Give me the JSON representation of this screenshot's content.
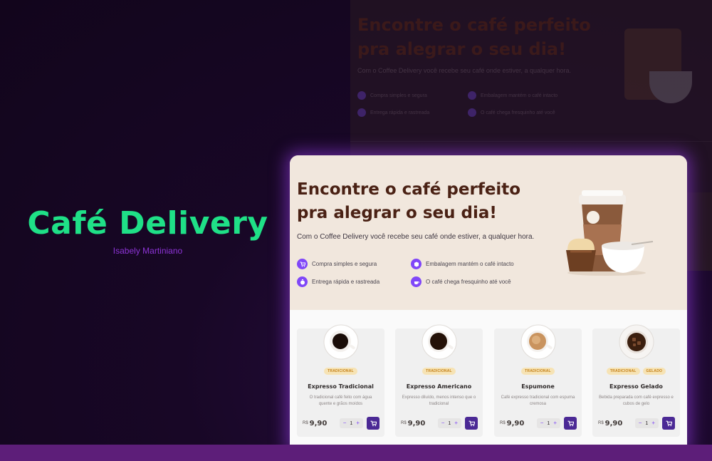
{
  "brand": {
    "title": "Café Delivery",
    "author": "Isabely Martiniano"
  },
  "background_copy": {
    "title": "Encontre o café perfeito pra alegrar o seu dia!",
    "subtitle": "Com o Coffee Delivery você recebe seu café onde estiver, a qualquer hora.",
    "features": [
      "Compra simples e segura",
      "Embalagem mantém o café intacto",
      "Entrega rápida e rastreada",
      "O café chega fresquinho até você"
    ]
  },
  "hero": {
    "title_line1": "Encontre o café perfeito",
    "title_line2": "pra alegrar o seu dia!",
    "subtitle": "Com o Coffee Delivery você recebe seu café onde estiver, a qualquer hora.",
    "features": [
      {
        "label": "Compra simples e segura",
        "icon": "cart-icon",
        "symbol": "🛒"
      },
      {
        "label": "Embalagem mantém o café intacto",
        "icon": "package-icon",
        "symbol": "◈"
      },
      {
        "label": "Entrega rápida e rastreada",
        "icon": "timer-icon",
        "symbol": "◷"
      },
      {
        "label": "O café chega fresquinho até você",
        "icon": "coffee-icon",
        "symbol": "☕"
      }
    ]
  },
  "products": [
    {
      "name": "Expresso Tradicional",
      "tags": [
        "Tradicional"
      ],
      "description": "O tradicional café feito com água quente e grãos moídos",
      "currency": "R$",
      "price": "9,90",
      "quantity": "1",
      "coffee_color": "#1a0d08"
    },
    {
      "name": "Expresso Americano",
      "tags": [
        "Tradicional"
      ],
      "description": "Expresso diluído, menos intenso que o tradicional",
      "currency": "R$",
      "price": "9,90",
      "quantity": "1",
      "coffee_color": "#241208"
    },
    {
      "name": "Espumone",
      "tags": [
        "Tradicional"
      ],
      "description": "Café expresso tradicional com espuma cremosa",
      "currency": "R$",
      "price": "9,90",
      "quantity": "1",
      "coffee_color": "#c9935e"
    },
    {
      "name": "Expresso Gelado",
      "tags": [
        "Tradicional",
        "Gelado"
      ],
      "description": "Bebida preparada com café expresso e cubos de gelo",
      "currency": "R$",
      "price": "9,90",
      "quantity": "1",
      "coffee_color": "#3b1f0f"
    }
  ],
  "stepper": {
    "minus": "−",
    "plus": "+"
  },
  "colors": {
    "brand_green": "#1fe087",
    "author_purple": "#8d34d6",
    "accent_purple": "#8047f8",
    "cart_purple": "#4b2995",
    "hero_bg": "#f1e7dd",
    "title_brown": "#4a2114"
  }
}
